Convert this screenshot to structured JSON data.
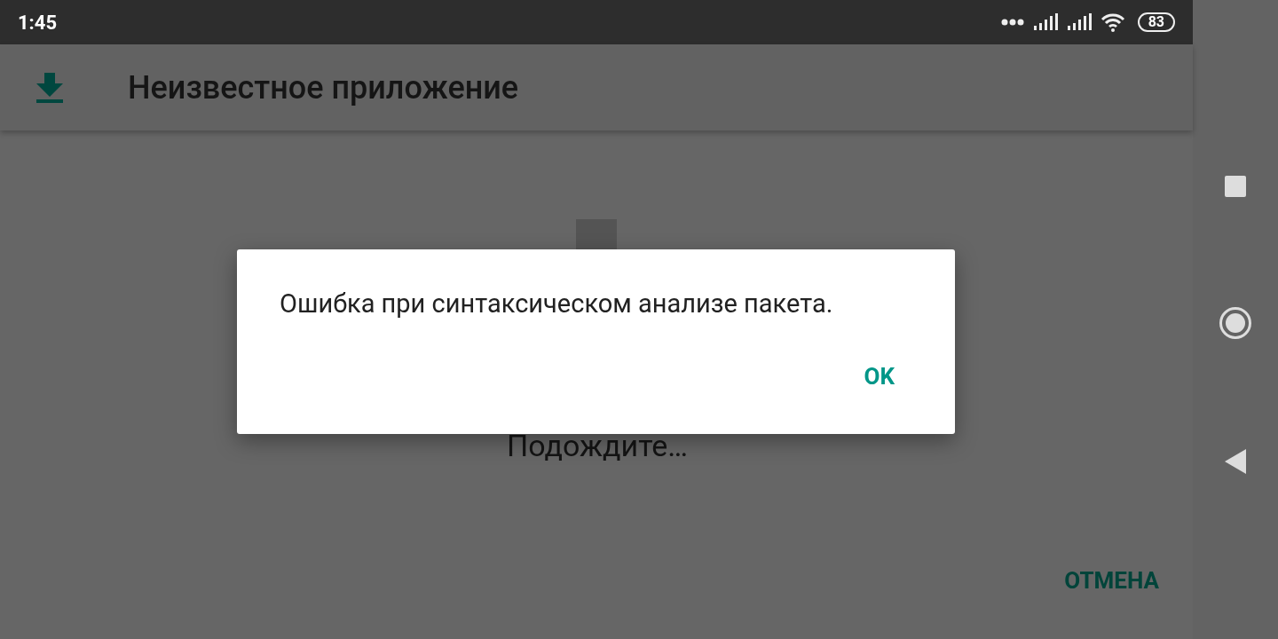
{
  "status_bar": {
    "time": "1:45",
    "battery": "83"
  },
  "app_bar": {
    "title": "Неизвестное приложение"
  },
  "content": {
    "message": "Подождите…",
    "cancel_button": "ОТМЕНА"
  },
  "dialog": {
    "message": "Ошибка при синтаксическом анализе пакета.",
    "buttons": [
      "OK"
    ]
  }
}
